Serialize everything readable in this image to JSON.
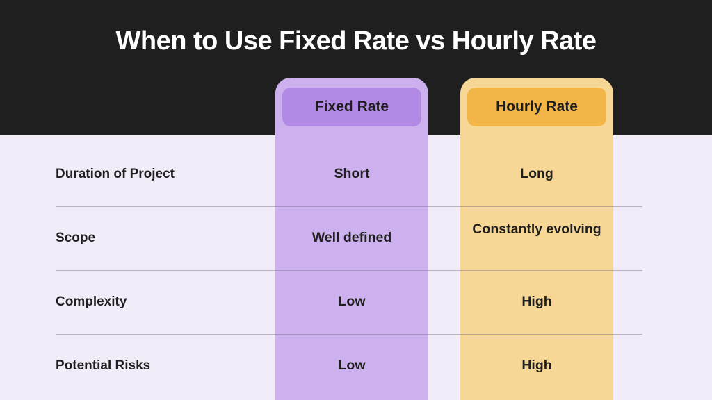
{
  "title": "When to Use Fixed Rate vs Hourly Rate",
  "columns": {
    "fixed": {
      "label": "Fixed Rate"
    },
    "hourly": {
      "label": "Hourly Rate"
    }
  },
  "rows": [
    {
      "label": "Duration of Project",
      "fixed": "Short",
      "hourly": "Long"
    },
    {
      "label": "Scope",
      "fixed": "Well defined",
      "hourly": "Constantly evolving"
    },
    {
      "label": "Complexity",
      "fixed": "Low",
      "hourly": "High"
    },
    {
      "label": "Potential Risks",
      "fixed": "Low",
      "hourly": "High"
    }
  ],
  "chart_data": {
    "type": "table",
    "title": "When to Use Fixed Rate vs Hourly Rate",
    "columns": [
      "Fixed Rate",
      "Hourly Rate"
    ],
    "rows": [
      "Duration of Project",
      "Scope",
      "Complexity",
      "Potential Risks"
    ],
    "cells": [
      [
        "Short",
        "Long"
      ],
      [
        "Well defined",
        "Constantly evolving"
      ],
      [
        "Low",
        "High"
      ],
      [
        "Low",
        "High"
      ]
    ]
  }
}
